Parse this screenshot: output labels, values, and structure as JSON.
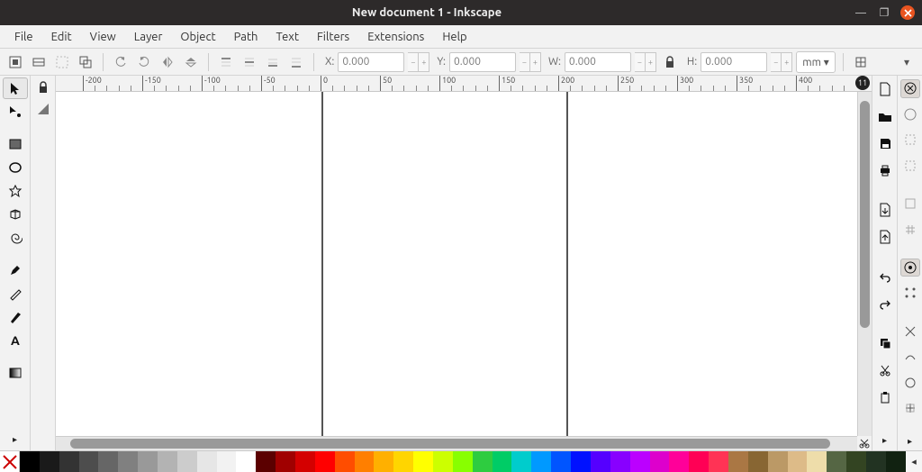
{
  "window": {
    "title": "New document 1 - Inkscape"
  },
  "menu": [
    "File",
    "Edit",
    "View",
    "Layer",
    "Object",
    "Path",
    "Text",
    "Filters",
    "Extensions",
    "Help"
  ],
  "options": {
    "x_label": "X:",
    "x_value": "0.000",
    "y_label": "Y:",
    "y_value": "0.000",
    "w_label": "W:",
    "w_value": "0.000",
    "h_label": "H:",
    "h_value": "0.000",
    "unit": "mm ▾"
  },
  "ruler": {
    "ticks": [
      "-200",
      "-150",
      "-100",
      "-50",
      "0",
      "50",
      "100",
      "150",
      "200",
      "250",
      "300",
      "350",
      "400"
    ]
  },
  "tools": [
    {
      "id": "selector",
      "active": true
    },
    {
      "id": "node"
    },
    {
      "id": "rect"
    },
    {
      "id": "circle"
    },
    {
      "id": "star"
    },
    {
      "id": "3dbox"
    },
    {
      "id": "spiral"
    },
    {
      "id": "pen"
    },
    {
      "id": "pencil"
    },
    {
      "id": "calligraphy"
    },
    {
      "id": "text"
    },
    {
      "id": "gradient"
    }
  ],
  "right_a": [
    "new",
    "open",
    "save",
    "print",
    "",
    "import",
    "export",
    "",
    "undo",
    "redo",
    "",
    "copy",
    "cut",
    "paste"
  ],
  "right_b": [
    "rotate-ccw",
    "rotate-cw",
    "blank",
    "blank",
    "",
    "page",
    "page",
    "",
    "return",
    "dots",
    "",
    "cross",
    "curve",
    "circ",
    "center"
  ],
  "palette": [
    "#000000",
    "#1a1a1a",
    "#333333",
    "#4d4d4d",
    "#666666",
    "#808080",
    "#999999",
    "#b3b3b3",
    "#cccccc",
    "#e6e6e6",
    "#f2f2f2",
    "#ffffff",
    "#5b0000",
    "#a00000",
    "#d40000",
    "#ff0000",
    "#ff4d00",
    "#ff7f00",
    "#ffb000",
    "#ffd500",
    "#ffff00",
    "#ccff00",
    "#88ff00",
    "#2ecc40",
    "#00cc66",
    "#00cccc",
    "#0099ff",
    "#0055ff",
    "#0011ff",
    "#5500ff",
    "#8800ff",
    "#bb00ff",
    "#dd00cc",
    "#ff0099",
    "#ff0055",
    "#ff3355",
    "#aa7744",
    "#886633",
    "#bb9966",
    "#ddbb88",
    "#eeddaa",
    "#556644",
    "#334422",
    "#223322",
    "#112211"
  ],
  "badge": "11"
}
